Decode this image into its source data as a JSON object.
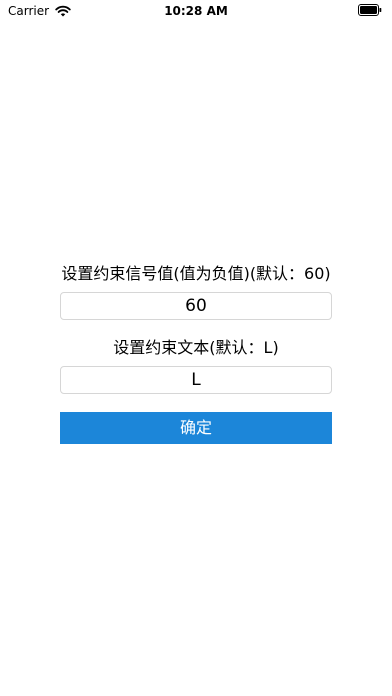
{
  "status_bar": {
    "carrier": "Carrier",
    "time": "10:28 AM",
    "wifi_icon": "wifi-icon",
    "battery_icon": "battery-icon"
  },
  "form": {
    "signal_label": "设置约束信号值(值为负值)(默认：60)",
    "signal_value": "60",
    "text_label": "设置约束文本(默认：L)",
    "text_value": "L",
    "confirm_label": "确定"
  },
  "colors": {
    "button_background": "#1c86d9",
    "button_text": "#ffffff",
    "input_border": "#d6d6d6"
  }
}
